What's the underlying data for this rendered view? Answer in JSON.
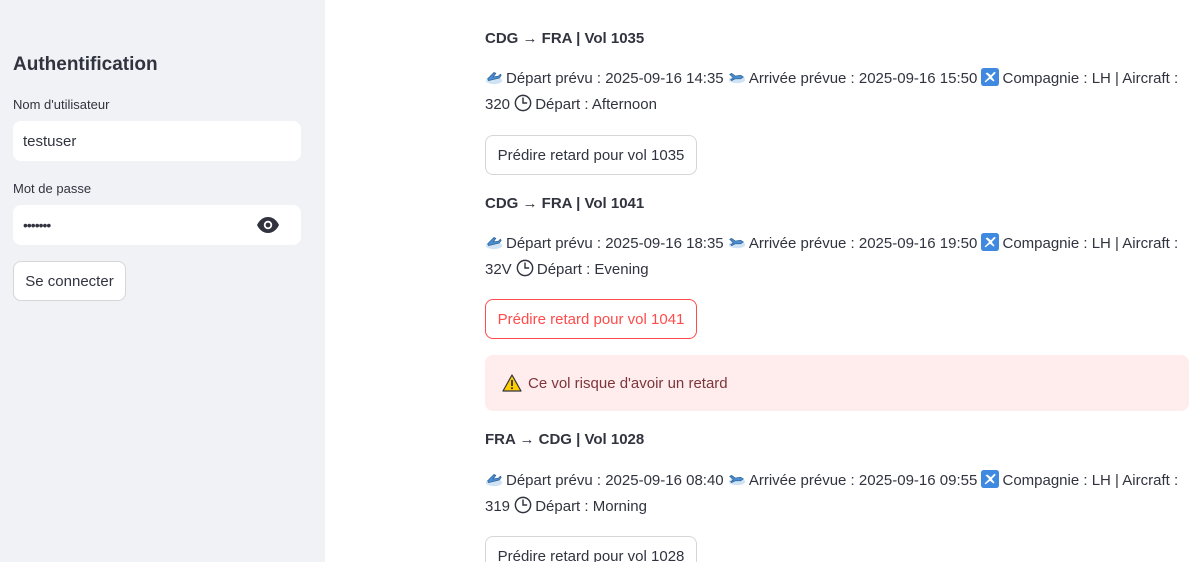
{
  "sidebar": {
    "title": "Authentification",
    "username_label": "Nom d'utilisateur",
    "username_value": "testuser",
    "password_label": "Mot de passe",
    "password_value": "•••••••",
    "login_button": "Se connecter"
  },
  "flights": [
    {
      "title": "CDG → FRA | Vol 1035",
      "depart_planned": "Départ prévu : 2025-09-16 14:35",
      "arrival_planned": "Arrivée prévue : 2025-09-16 15:50",
      "company_line_1": "Compagnie : LH | Aircraft :",
      "aircraft": "320",
      "depart_period": "Départ : Afternoon",
      "button": "Prédire retard pour vol 1035"
    },
    {
      "title": "CDG → FRA | Vol 1041",
      "depart_planned": "Départ prévu : 2025-09-16 18:35",
      "arrival_planned": "Arrivée prévue : 2025-09-16 19:50",
      "company_line_1": "Compagnie : LH | Aircraft :",
      "aircraft": "32V",
      "depart_period": "Départ : Evening",
      "button": "Prédire retard pour vol 1041"
    },
    {
      "title": "FRA → CDG | Vol 1028",
      "depart_planned": "Départ prévu : 2025-09-16 08:40",
      "arrival_planned": "Arrivée prévue : 2025-09-16 09:55",
      "company_line_1": "Compagnie : LH | Aircraft :",
      "aircraft": "319",
      "depart_period": "Départ : Morning",
      "button": "Prédire retard pour vol 1028"
    }
  ],
  "alert": {
    "text": "Ce vol risque d'avoir un retard",
    "icon": "warning-icon",
    "background": "#ffeded",
    "color": "#7d353b"
  },
  "colors": {
    "accent": "#ff4b4b",
    "sidebar_bg": "#f0f2f6"
  }
}
